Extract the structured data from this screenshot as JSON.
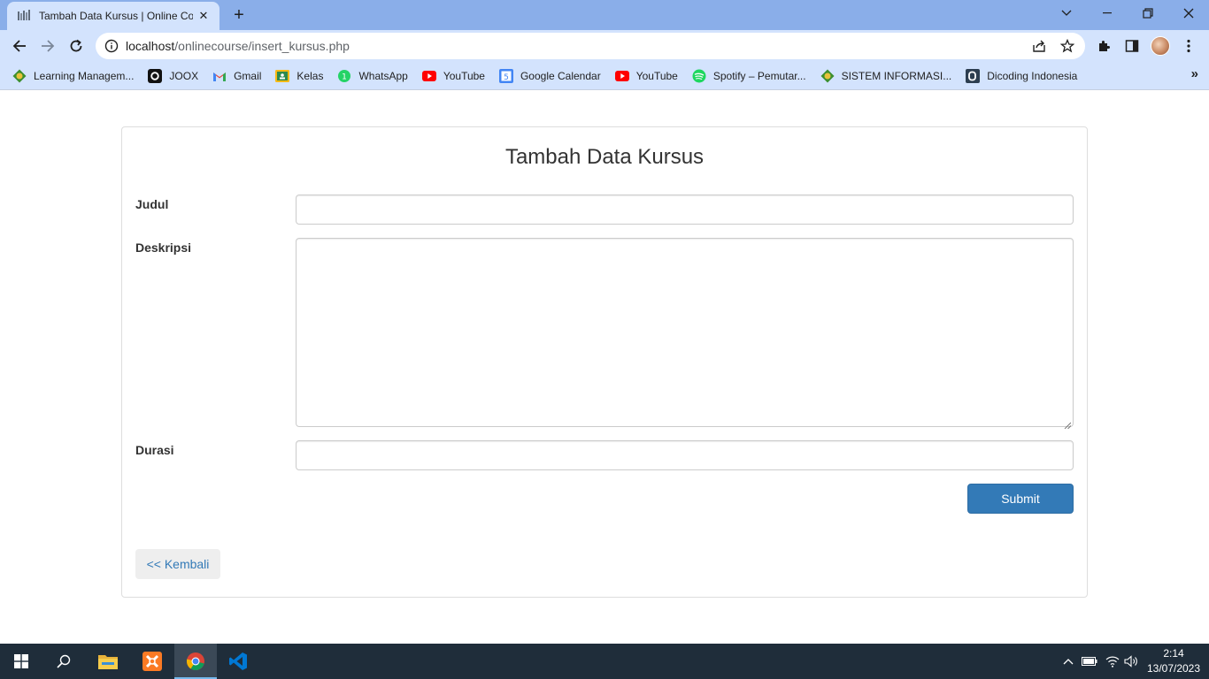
{
  "browser": {
    "tab_title": "Tambah Data Kursus | Online Cou",
    "tab_close": "✕",
    "new_tab": "+",
    "url_host": "localhost",
    "url_path": "/onlinecourse/insert_kursus.php"
  },
  "bookmarks": [
    {
      "label": "Learning Managem...",
      "icon": "campus-logo-icon"
    },
    {
      "label": "JOOX",
      "icon": "joox-icon"
    },
    {
      "label": "Gmail",
      "icon": "gmail-icon"
    },
    {
      "label": "Kelas",
      "icon": "classroom-icon"
    },
    {
      "label": "WhatsApp",
      "icon": "whatsapp-icon"
    },
    {
      "label": "YouTube",
      "icon": "youtube-icon"
    },
    {
      "label": "Google Calendar",
      "icon": "calendar-icon"
    },
    {
      "label": "YouTube",
      "icon": "youtube-icon"
    },
    {
      "label": "Spotify – Pemutar...",
      "icon": "spotify-icon"
    },
    {
      "label": "SISTEM INFORMASI...",
      "icon": "campus-logo-icon"
    },
    {
      "label": "Dicoding Indonesia",
      "icon": "dicoding-icon"
    }
  ],
  "bookmarks_more": "»",
  "form": {
    "title": "Tambah Data Kursus",
    "judul_label": "Judul",
    "judul_value": "",
    "deskripsi_label": "Deskripsi",
    "deskripsi_value": "",
    "durasi_label": "Durasi",
    "durasi_value": "",
    "submit_label": "Submit",
    "back_label": "<< Kembali"
  },
  "taskbar": {
    "time": "2:14",
    "date": "13/07/2023"
  },
  "colors": {
    "primary_button": "#337ab7",
    "link": "#337ab7",
    "chrome_frame": "#8aaee9",
    "chrome_toolbar": "#d3e3fd",
    "taskbar": "#1f2d3a"
  }
}
